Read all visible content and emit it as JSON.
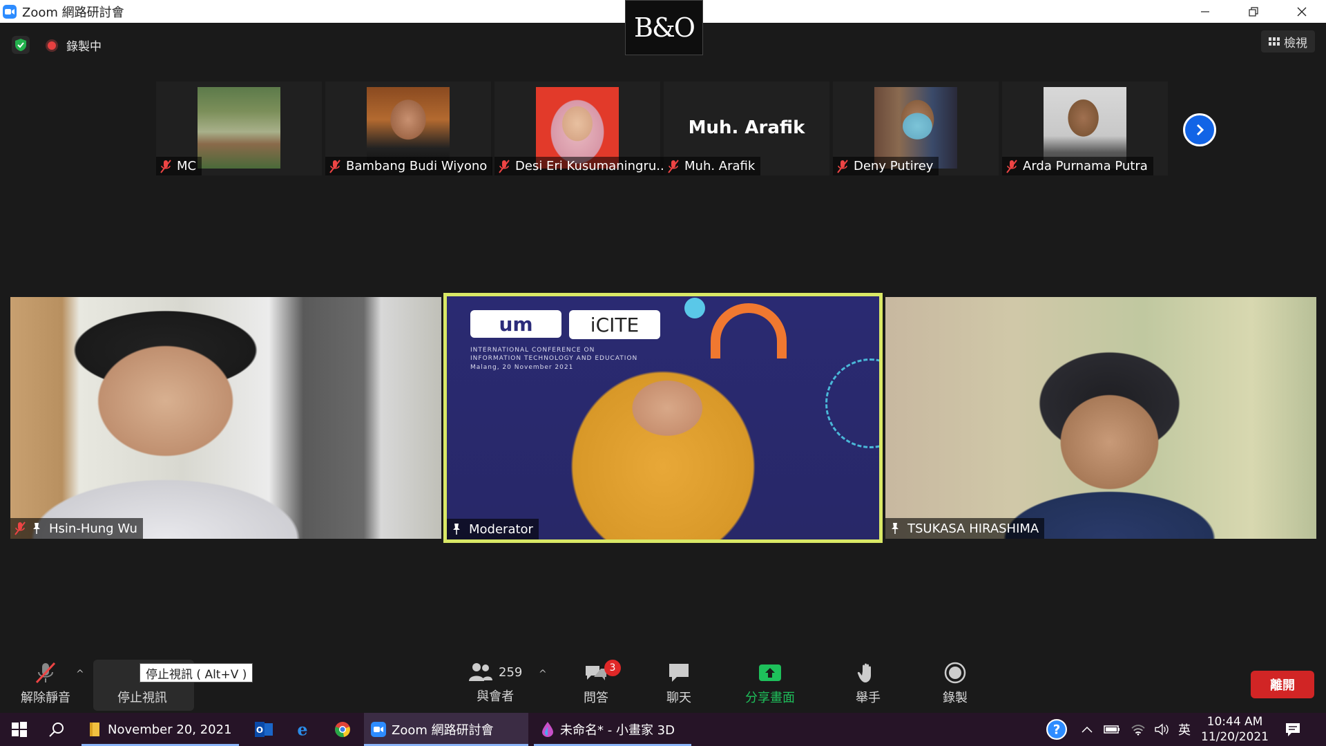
{
  "window": {
    "title": "Zoom 網路研討會",
    "brand_logo": "B&O"
  },
  "status": {
    "recording_label": "錄製中",
    "view_label": "檢視"
  },
  "thumbnails": [
    {
      "name": "MC",
      "muted": true
    },
    {
      "name": "Bambang Budi Wiyono",
      "muted": true
    },
    {
      "name": "Desi Eri Kusumaningru...",
      "muted": true
    },
    {
      "name": "Muh. Arafik",
      "muted": true,
      "display_name": "Muh. Arafik"
    },
    {
      "name": "Deny Putirey",
      "muted": true
    },
    {
      "name": "Arda Purnama Putra",
      "muted": true
    }
  ],
  "main_tiles": [
    {
      "name": "Hsin-Hung Wu",
      "muted": true,
      "pinned": true
    },
    {
      "name": "Moderator",
      "muted": false,
      "pinned": true,
      "active_speaker": true,
      "slide_text": "INTERNATIONAL CONFERENCE ON INFORMATION TECHNOLOGY AND EDUCATION",
      "slide_date": "Malang, 20 November 2021",
      "slide_logo_left": "um",
      "slide_logo_right": "iCITE"
    },
    {
      "name": "TSUKASA HIRASHIMA",
      "muted": false,
      "pinned": true
    }
  ],
  "toolbar": {
    "unmute_label": "解除靜音",
    "stop_video_label": "停止視訊",
    "stop_video_tooltip": "停止視訊 ( Alt+V )",
    "participants_label": "與會者",
    "participants_count": "259",
    "qa_label": "問答",
    "qa_badge": "3",
    "chat_label": "聊天",
    "share_label": "分享畫面",
    "raise_hand_label": "舉手",
    "record_label": "錄製",
    "leave_label": "離開"
  },
  "taskbar": {
    "folder_label": "November 20, 2021",
    "zoom_label": "Zoom 網路研討會",
    "paint_label": "未命名* - 小畫家 3D",
    "ime_label": "英",
    "time": "10:44 AM",
    "date": "11/20/2021"
  },
  "colors": {
    "accent_blue": "#2d8cff",
    "leave_red": "#d12525",
    "active_border": "#d9e866",
    "share_green": "#1ec05b",
    "taskbar_bg": "#261427"
  }
}
